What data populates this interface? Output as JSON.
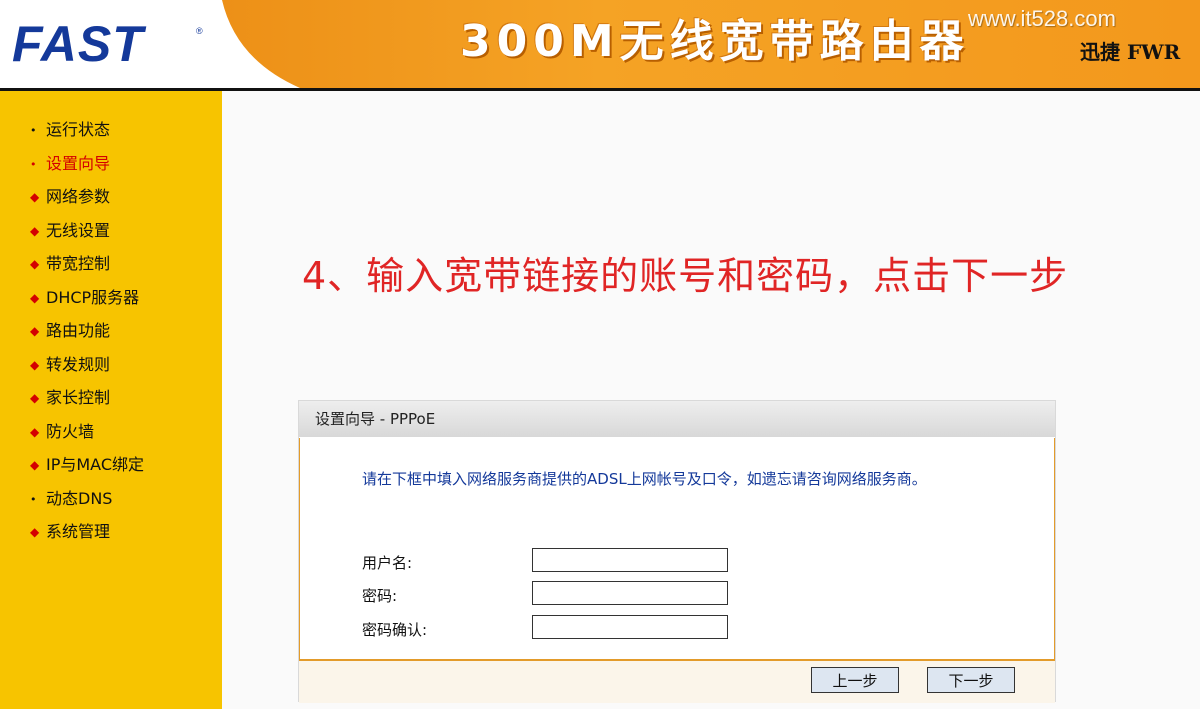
{
  "header": {
    "logo": "FAST",
    "logo_mark": "®",
    "product_title": "300M无线宽带路由器",
    "watermark": "www.it528.com",
    "brand_model": "迅捷 FWR",
    "colors": {
      "orange": "#f0901a",
      "logo_blue": "#14399a"
    }
  },
  "sidebar": {
    "color": "#f7c400",
    "items": [
      {
        "label": "运行状态",
        "icon": "dot-bullet"
      },
      {
        "label": "设置向导",
        "icon": "dot-bullet",
        "active": true
      },
      {
        "label": "网络参数",
        "icon": "diamond-bullet"
      },
      {
        "label": "无线设置",
        "icon": "diamond-bullet"
      },
      {
        "label": "带宽控制",
        "icon": "diamond-bullet"
      },
      {
        "label": "DHCP服务器",
        "icon": "diamond-bullet"
      },
      {
        "label": "路由功能",
        "icon": "diamond-bullet"
      },
      {
        "label": "转发规则",
        "icon": "diamond-bullet"
      },
      {
        "label": "家长控制",
        "icon": "diamond-bullet"
      },
      {
        "label": "防火墙",
        "icon": "diamond-bullet"
      },
      {
        "label": "IP与MAC绑定",
        "icon": "diamond-bullet"
      },
      {
        "label": "动态DNS",
        "icon": "dot-bullet"
      },
      {
        "label": "系统管理",
        "icon": "diamond-bullet"
      }
    ]
  },
  "main": {
    "instruction": "4、输入宽带链接的账号和密码，点击下一步",
    "instruction_color": "#e02525"
  },
  "wizard": {
    "title": "设置向导 - PPPoE",
    "description": "请在下框中填入网络服务商提供的ADSL上网帐号及口令，如遗忘请咨询网络服务商。",
    "fields": {
      "username": {
        "label": "用户名:",
        "value": ""
      },
      "password": {
        "label": "密码:",
        "value": ""
      },
      "confirm": {
        "label": "密码确认:",
        "value": ""
      }
    },
    "buttons": {
      "prev": "上一步",
      "next": "下一步"
    }
  }
}
